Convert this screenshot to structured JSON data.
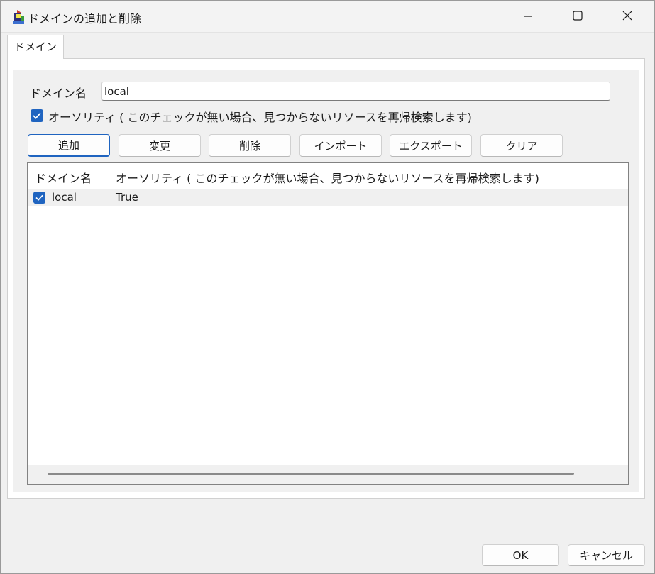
{
  "window": {
    "title": "ドメインの追加と削除",
    "icons": {
      "app": "app-icon",
      "minimize": "minimize-icon",
      "maximize": "maximize-icon",
      "close": "close-icon"
    }
  },
  "tabs": [
    {
      "label": "ドメイン",
      "selected": true
    }
  ],
  "form": {
    "domain_label": "ドメイン名",
    "domain_value": "local",
    "authority_checkbox": {
      "checked": true,
      "label": "オーソリティ ( このチェックが無い場合、見つからないリソースを再帰検索します)"
    }
  },
  "buttons": {
    "add": "追加",
    "change": "変更",
    "delete": "削除",
    "import": "インポート",
    "export": "エクスポート",
    "clear": "クリア"
  },
  "table": {
    "columns": [
      "ドメイン名",
      "オーソリティ ( このチェックが無い場合、見つからないリソースを再帰検索します)"
    ],
    "rows": [
      {
        "checked": true,
        "domain": "local",
        "authority": "True"
      }
    ]
  },
  "dialog_buttons": {
    "ok": "OK",
    "cancel": "キャンセル"
  },
  "colors": {
    "accent": "#1f64c0",
    "background": "#f0f0f0",
    "panel": "#ffffff"
  }
}
